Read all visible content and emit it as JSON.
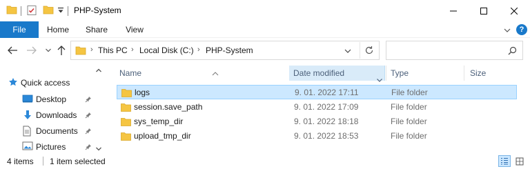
{
  "window": {
    "title": "PHP-System"
  },
  "ribbon": {
    "tabs": [
      {
        "label": "File",
        "active": true
      },
      {
        "label": "Home"
      },
      {
        "label": "Share"
      },
      {
        "label": "View"
      }
    ],
    "help_label": "?"
  },
  "address": {
    "breadcrumbs": [
      "This PC",
      "Local Disk (C:)",
      "PHP-System"
    ],
    "separator": "›"
  },
  "search": {
    "placeholder": ""
  },
  "sidebar": {
    "items": [
      {
        "label": "Quick access",
        "icon": "star-icon"
      },
      {
        "label": "Desktop",
        "icon": "desktop-icon",
        "pinned": true
      },
      {
        "label": "Downloads",
        "icon": "download-arrow-icon",
        "pinned": true
      },
      {
        "label": "Documents",
        "icon": "document-icon",
        "pinned": true
      },
      {
        "label": "Pictures",
        "icon": "pictures-icon",
        "pinned": true
      }
    ]
  },
  "columns": {
    "name": "Name",
    "date": "Date modified",
    "type": "Type",
    "size": "Size"
  },
  "files": [
    {
      "name": "logs",
      "date": "9. 01. 2022 17:11",
      "type": "File folder",
      "selected": true
    },
    {
      "name": "session.save_path",
      "date": "9. 01. 2022 17:09",
      "type": "File folder"
    },
    {
      "name": "sys_temp_dir",
      "date": "9. 01. 2022 18:18",
      "type": "File folder"
    },
    {
      "name": "upload_tmp_dir",
      "date": "9. 01. 2022 18:53",
      "type": "File folder"
    }
  ],
  "status": {
    "item_count": "4 items",
    "selection": "1 item selected"
  },
  "colors": {
    "accent": "#1979ca",
    "folder": "#f5c542",
    "selection_bg": "#cce8ff",
    "selection_border": "#99d1ff"
  }
}
